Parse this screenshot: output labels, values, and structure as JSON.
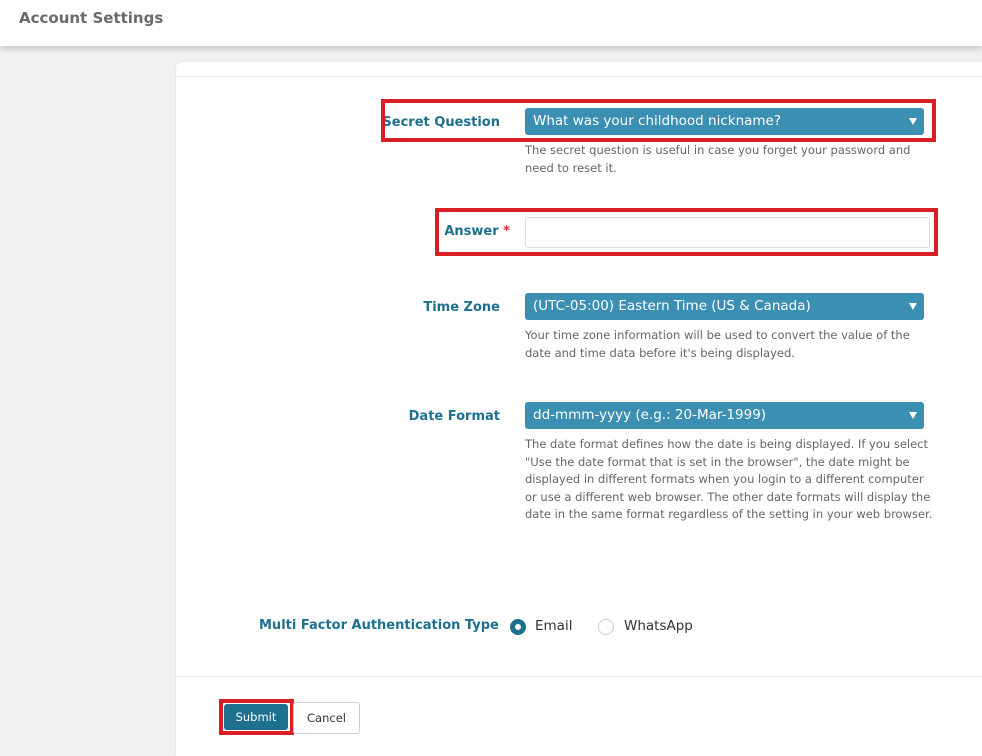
{
  "header": {
    "title": "Account Settings"
  },
  "form": {
    "secret_question": {
      "label": "Secret Question",
      "value": "What was your childhood nickname?",
      "help": "The secret question is useful in case you forget your password and need to reset it."
    },
    "answer": {
      "label": "Answer",
      "required_mark": "*",
      "value": ""
    },
    "time_zone": {
      "label": "Time Zone",
      "value": "(UTC-05:00) Eastern Time (US & Canada)",
      "help": "Your time zone information will be used to convert the value of the date and time data before it's being displayed."
    },
    "date_format": {
      "label": "Date Format",
      "value": "dd-mmm-yyyy (e.g.: 20-Mar-1999)",
      "help": "The date format defines how the date is being displayed. If you select \"Use the date format that is set in the browser\", the date might be displayed in different formats when you login to a different computer or use a different web browser. The other date formats will display the date in the same format regardless of the setting in your web browser."
    },
    "mfa": {
      "label": "Multi Factor Authentication Type",
      "options": [
        {
          "label": "Email",
          "selected": true
        },
        {
          "label": "WhatsApp",
          "selected": false
        }
      ]
    }
  },
  "actions": {
    "submit_label": "Submit",
    "cancel_label": "Cancel"
  },
  "colors": {
    "accent": "#3b8fb2",
    "label": "#1f6f8f",
    "highlight": "#d61f26",
    "button_primary": "#1f6f8f"
  }
}
